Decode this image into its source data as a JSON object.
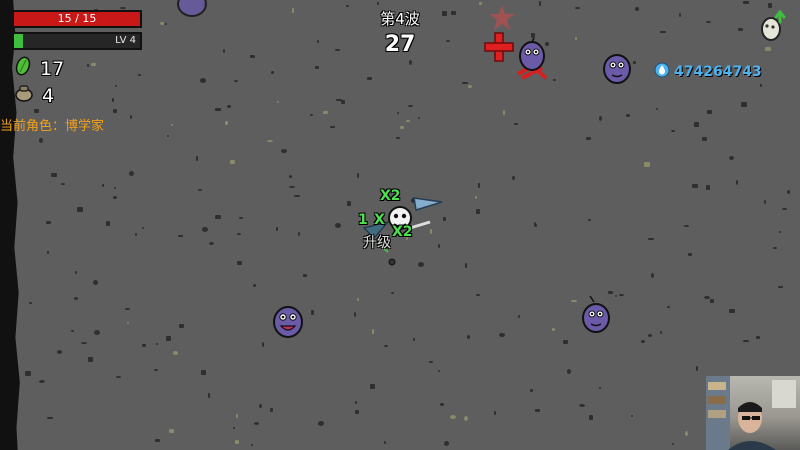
{
  "hud": {
    "hp_text": "15 / 15",
    "hp_fraction": 1.0,
    "xp_text": "LV 4",
    "xp_fraction": 0.07,
    "materials_count": "17",
    "bag_count": "4",
    "current_character": "当前角色：博学家"
  },
  "wave": {
    "label": "第4波",
    "timer": "27"
  },
  "score": {
    "value": "474264743"
  },
  "floating_text": {
    "x2_top": "X2",
    "x2_mid": "X2",
    "plus_one": "1",
    "x_partial": "X",
    "level_up": "升级"
  },
  "colors": {
    "background": "#5e5e5e",
    "hp_red": "#c81818",
    "xp_green": "#3fbf3f",
    "character_label": "#f2a11a",
    "score_blue": "#4db2f0",
    "enemy_purple": "#6a5aa8"
  },
  "icons": {
    "materials": "green-leaf-icon",
    "bag": "loot-bag-icon",
    "score": "water-drop-icon",
    "egg": "egg-upgrade-icon"
  }
}
